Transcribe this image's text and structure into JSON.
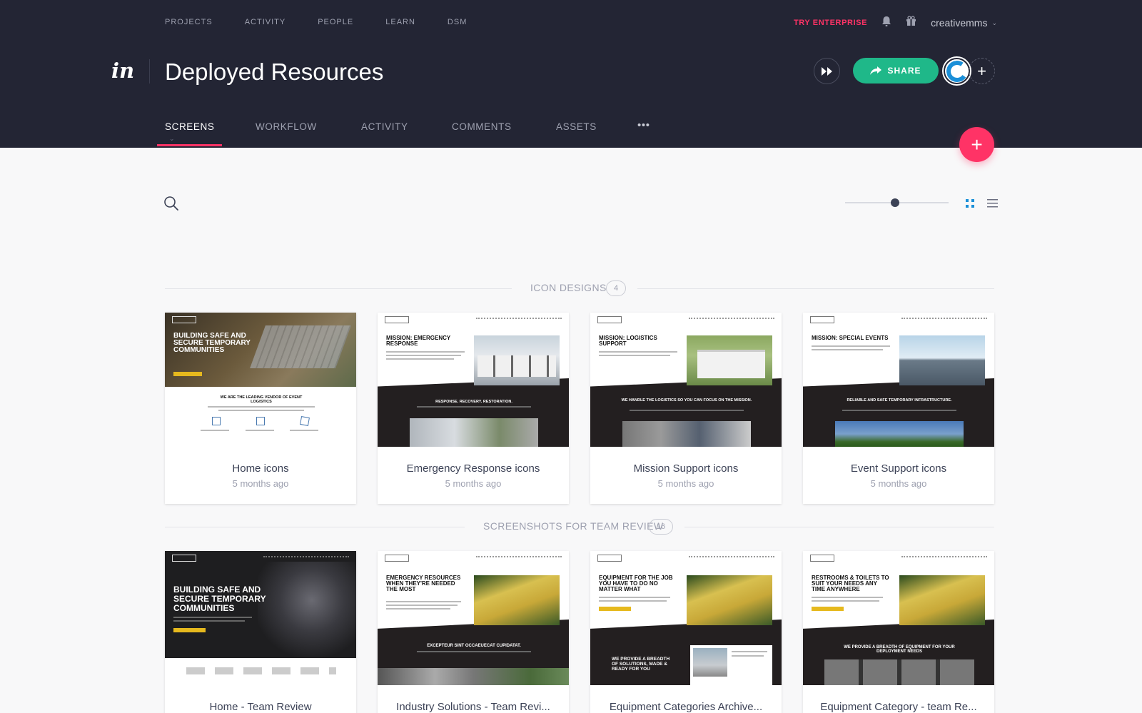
{
  "top_nav": {
    "items": [
      "PROJECTS",
      "ACTIVITY",
      "PEOPLE",
      "LEARN",
      "DSM"
    ],
    "try_enterprise": "TRY ENTERPRISE",
    "username": "creativemms"
  },
  "header": {
    "logo": "in",
    "title": "Deployed Resources",
    "share_label": "SHARE"
  },
  "tabs": {
    "screens": "SCREENS",
    "workflow": "WORKFLOW",
    "activity": "ACTIVITY",
    "comments": "COMMENTS",
    "assets": "ASSETS",
    "more": "•••"
  },
  "colors": {
    "header_bg": "#232534",
    "accent": "#ff3366",
    "share": "#1fb889",
    "view_active": "#1a8fd8"
  },
  "sections": [
    {
      "title": "ICON DESIGNS",
      "count": "4",
      "cards": [
        {
          "title": "Home icons",
          "time": "5 months ago",
          "headline": "BUILDING SAFE AND SECURE TEMPORARY COMMUNITIES",
          "sub": "WE ARE THE LEADING VENDOR OF EVENT LOGISTICS"
        },
        {
          "title": "Emergency Response icons",
          "time": "5 months ago",
          "headline": "MISSION: EMERGENCY RESPONSE",
          "sub": "RESPONSE. RECOVERY. RESTORATION."
        },
        {
          "title": "Mission Support icons",
          "time": "5 months ago",
          "headline": "MISSION: LOGISTICS SUPPORT",
          "sub": "WE HANDLE THE LOGISTICS SO YOU CAN FOCUS ON THE MISSION."
        },
        {
          "title": "Event Support icons",
          "time": "5 months ago",
          "headline": "MISSION: SPECIAL EVENTS",
          "sub": "RELIABLE AND SAFE TEMPORARY INFRASTRUCTURE."
        }
      ]
    },
    {
      "title": "SCREENSHOTS FOR TEAM REVIEW",
      "count": "16",
      "cards": [
        {
          "title": "Home - Team Review",
          "headline": "BUILDING SAFE AND SECURE TEMPORARY COMMUNITIES"
        },
        {
          "title": "Industry Solutions - Team Revi...",
          "headline": "EMERGENCY RESOURCES WHEN THEY'RE NEEDED THE MOST",
          "sub": "EXCEPTEUR SINT OCCAEUECAT CUPIDATAT."
        },
        {
          "title": "Equipment Categories Archive...",
          "headline": "EQUIPMENT FOR THE JOB YOU HAVE TO DO NO MATTER WHAT",
          "sub": "WE PROVIDE A BREADTH OF SOLUTIONS, MADE & READY FOR YOU"
        },
        {
          "title": "Equipment Category - team Re...",
          "headline": "RESTROOMS & TOILETS TO SUIT YOUR NEEDS ANY TIME ANYWHERE",
          "sub": "WE PROVIDE A BREADTH OF EQUIPMENT FOR YOUR DEPLOYMENT NEEDS"
        }
      ]
    }
  ]
}
